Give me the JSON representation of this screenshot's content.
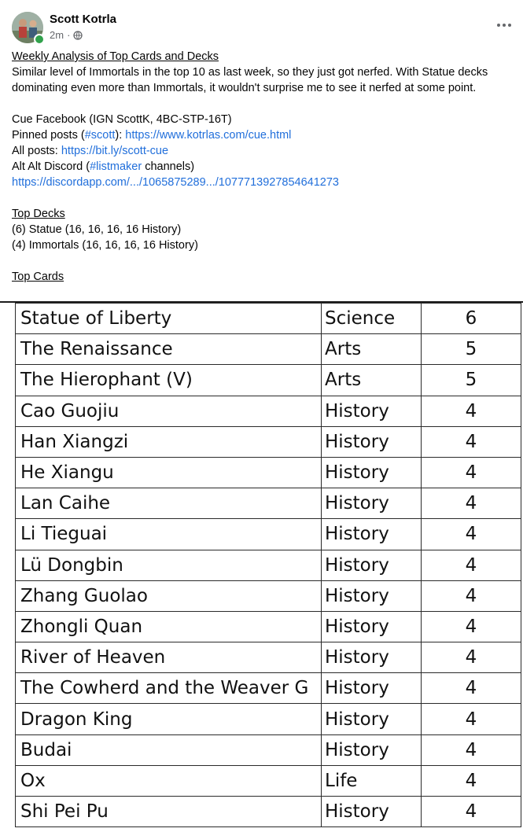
{
  "post": {
    "author": "Scott Kotrla",
    "time": "2m",
    "separator": "·",
    "avatar_icon": "profile-photo",
    "privacy_icon": "globe-icon",
    "more_icon": "more-options-icon"
  },
  "body": {
    "title": "Weekly Analysis of Top Cards and Decks",
    "para1_line1": "Similar level of Immortals in the top 10 as last week, so they just got nerfed. With Statue decks",
    "para1_line2": "dominating even more than Immortals, it wouldn't surprise me to see it nerfed at some point.",
    "cue_line": "Cue Facebook (IGN ScottK, 4BC-STP-16T)",
    "pinned_prefix": "Pinned posts (",
    "pinned_hashtag": "#scott",
    "pinned_mid": "): ",
    "pinned_link": "https://www.kotrlas.com/cue.html",
    "all_prefix": "All posts: ",
    "all_link": "https://bit.ly/scott-cue",
    "discord_prefix": "Alt Alt Discord (",
    "discord_hashtag": "#listmaker",
    "discord_suffix": " channels)",
    "discord_link": "https://discordapp.com/.../1065875289.../1077713927854641273",
    "top_decks_heading": "Top Decks",
    "decks": [
      "(6) Statue (16, 16, 16, 16 History)",
      "(4) Immortals (16, 16, 16, 16 History)"
    ],
    "top_cards_heading": "Top Cards"
  },
  "cards_table": [
    {
      "name": "Statue of Liberty",
      "category": "Science",
      "count": "6"
    },
    {
      "name": "The Renaissance",
      "category": "Arts",
      "count": "5"
    },
    {
      "name": "The Hierophant (V)",
      "category": "Arts",
      "count": "5"
    },
    {
      "name": "Cao Guojiu",
      "category": "History",
      "count": "4"
    },
    {
      "name": "Han Xiangzi",
      "category": "History",
      "count": "4"
    },
    {
      "name": "He Xiangu",
      "category": "History",
      "count": "4"
    },
    {
      "name": "Lan Caihe",
      "category": "History",
      "count": "4"
    },
    {
      "name": "Li Tieguai",
      "category": "History",
      "count": "4"
    },
    {
      "name": "Lü Dongbin",
      "category": "History",
      "count": "4"
    },
    {
      "name": "Zhang Guolao",
      "category": "History",
      "count": "4"
    },
    {
      "name": "Zhongli Quan",
      "category": "History",
      "count": "4"
    },
    {
      "name": "River of Heaven",
      "category": "History",
      "count": "4"
    },
    {
      "name": "The Cowherd and the Weaver G",
      "category": "History",
      "count": "4"
    },
    {
      "name": "Dragon King",
      "category": "History",
      "count": "4"
    },
    {
      "name": "Budai",
      "category": "History",
      "count": "4"
    },
    {
      "name": "Ox",
      "category": "Life",
      "count": "4"
    },
    {
      "name": "Shi Pei Pu",
      "category": "History",
      "count": "4"
    }
  ]
}
